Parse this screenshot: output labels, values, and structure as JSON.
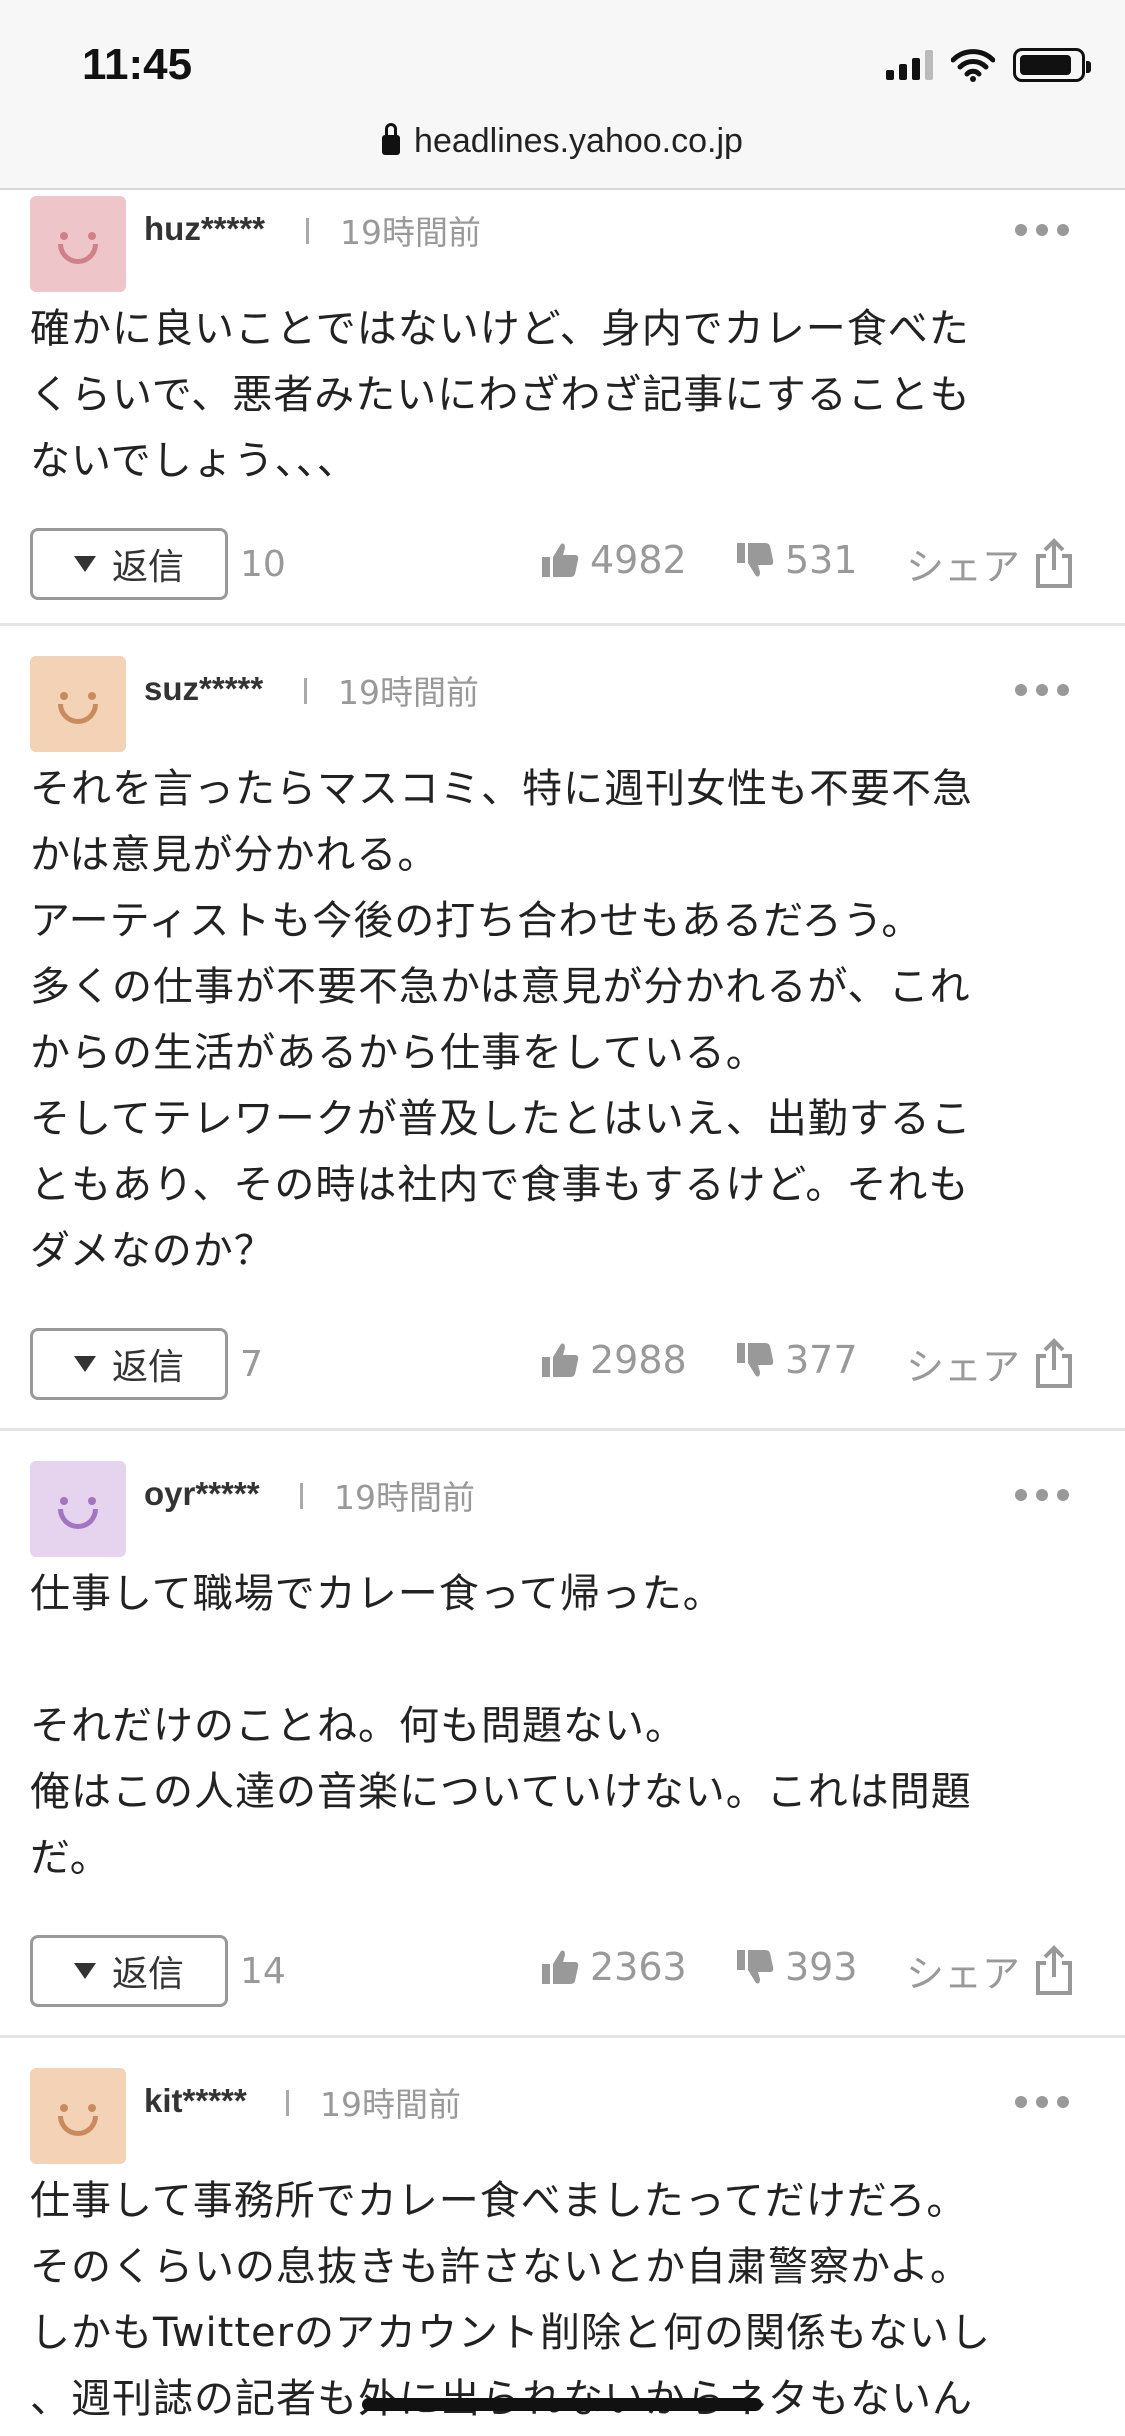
{
  "status_bar": {
    "time": "11:45"
  },
  "browser": {
    "url": "headlines.yahoo.co.jp"
  },
  "reply_label": "返信",
  "share_label": "シェア",
  "comments": [
    {
      "user": "huz*****",
      "time_ago": "19時間前",
      "avatar_color": "#eec5c8",
      "avatar_face_color": "#cf8088",
      "text": "確かに良いことではないけど、身内でカレー食べた\nくらいで、悪者みたいにわざわざ記事にすることも\nないでしょう、、、",
      "replies": "10",
      "likes": "4982",
      "dislikes": "531"
    },
    {
      "user": "suz*****",
      "time_ago": "19時間前",
      "avatar_color": "#f3d2b6",
      "avatar_face_color": "#c98b5e",
      "text": "それを言ったらマスコミ、特に週刊女性も不要不急\nかは意見が分かれる。\nアーティストも今後の打ち合わせもあるだろう。\n多くの仕事が不要不急かは意見が分かれるが、これ\nからの生活があるから仕事をしている。\nそしてテレワークが普及したとはいえ、出勤するこ\nともあり、その時は社内で食事もするけど。それも\nダメなのか？",
      "replies": "7",
      "likes": "2988",
      "dislikes": "377"
    },
    {
      "user": "oyr*****",
      "time_ago": "19時間前",
      "avatar_color": "#e6d3ee",
      "avatar_face_color": "#a275c0",
      "text": "仕事して職場でカレー食って帰った。\n\nそれだけのことね。何も問題ない。\n俺はこの人達の音楽についていけない。これは問題\nだ。",
      "replies": "14",
      "likes": "2363",
      "dislikes": "393"
    },
    {
      "user": "kit*****",
      "time_ago": "19時間前",
      "avatar_color": "#f3d2b6",
      "avatar_face_color": "#c98b5e",
      "text": "仕事して事務所でカレー食べましたってだけだろ。\nそのくらいの息抜きも許さないとか自粛警察かよ。\nしかもTwitterのアカウント削除と何の関係もないし\n、週刊誌の記者も外に出られないからネタもないん"
    }
  ]
}
